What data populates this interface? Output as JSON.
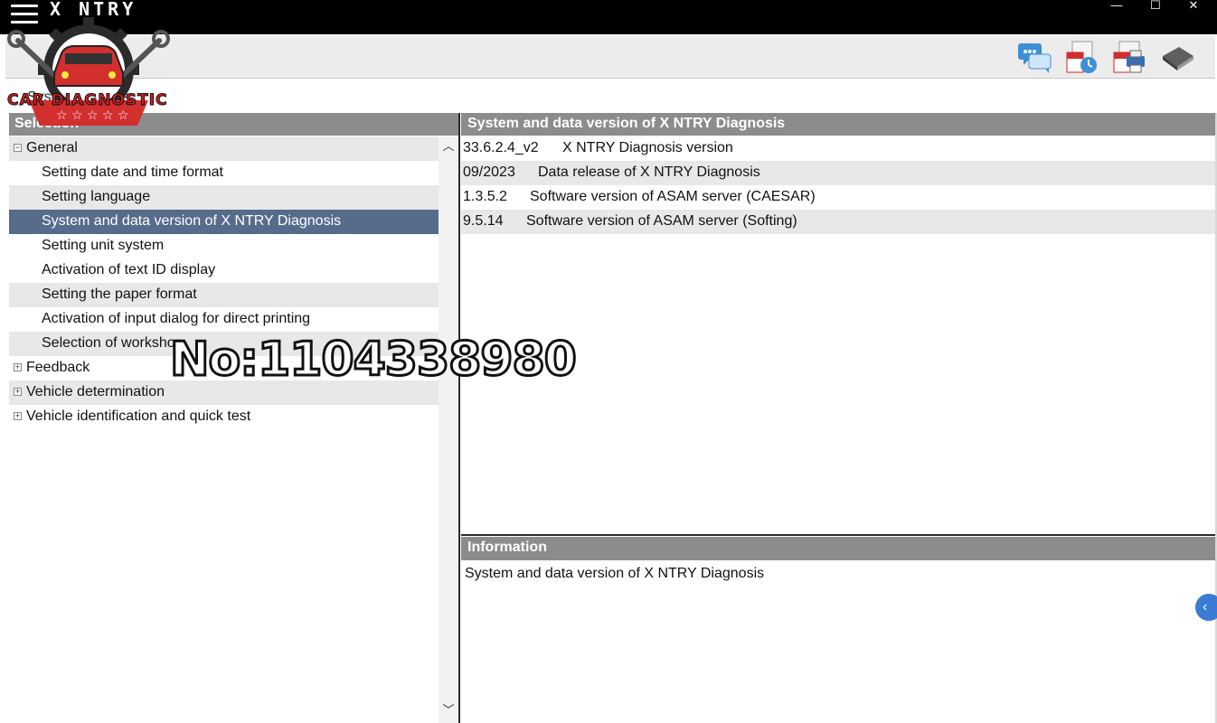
{
  "app": {
    "title": "X  NTRY"
  },
  "window": {
    "minimize": "—",
    "maximize": "☐",
    "close": "✕"
  },
  "toolbar": {
    "icons": [
      "chat-icon",
      "pdf-clock-icon",
      "pdf-printer-icon",
      "book-icon"
    ]
  },
  "section": {
    "system_settings": "System settings"
  },
  "left_panel": {
    "header": "Selection",
    "tree": [
      {
        "label": "General",
        "expander": "−",
        "level": 0
      },
      {
        "label": "Setting date and time format",
        "level": 1
      },
      {
        "label": "Setting language",
        "level": 1
      },
      {
        "label": "System and data version of X  NTRY Diagnosis",
        "level": 1,
        "selected": true
      },
      {
        "label": "Setting unit system",
        "level": 1
      },
      {
        "label": "Activation of text ID display",
        "level": 1
      },
      {
        "label": "Setting the paper format",
        "level": 1
      },
      {
        "label": "Activation of input dialog for direct printing",
        "level": 1
      },
      {
        "label": "Selection of workshop",
        "level": 1
      },
      {
        "label": "Feedback",
        "expander": "+",
        "level": 0
      },
      {
        "label": "Vehicle determination",
        "expander": "+",
        "level": 0
      },
      {
        "label": "Vehicle identification and quick test",
        "expander": "+",
        "level": 0
      }
    ]
  },
  "right_panel": {
    "header": "System and data version of X  NTRY Diagnosis",
    "rows": [
      {
        "version": "33.6.2.4_v2",
        "description": "X  NTRY Diagnosis version"
      },
      {
        "version": "09/2023",
        "description": "Data release of X  NTRY Diagnosis"
      },
      {
        "version": "1.3.5.2",
        "description": "Software version of ASAM server (CAESAR)"
      },
      {
        "version": "9.5.14",
        "description": "Software version of ASAM server (Softing)"
      }
    ]
  },
  "info_panel": {
    "header": "Information",
    "text": "System and data version of X  NTRY Diagnosis"
  },
  "overlay": {
    "logo_text": "CAR DIAGNOSTIC",
    "watermark": "No:1104338980"
  },
  "colors": {
    "selected_row": "#566c8a",
    "header_gray": "#8c8c8c",
    "accent_blue": "#3a7bd5"
  }
}
